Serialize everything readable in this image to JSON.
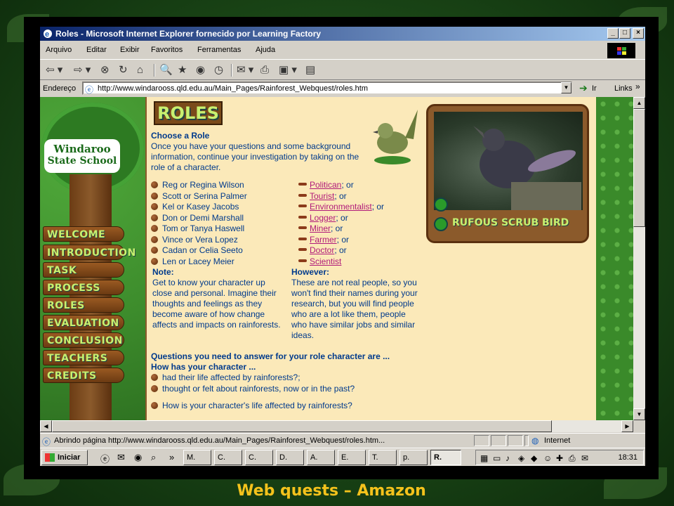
{
  "window": {
    "title": "Roles - Microsoft Internet Explorer fornecido por Learning Factory",
    "btn_min": "_",
    "btn_max": "□",
    "btn_close": "×"
  },
  "menu": [
    "Arquivo",
    "Editar",
    "Exibir",
    "Favoritos",
    "Ferramentas",
    "Ajuda"
  ],
  "address": {
    "label": "Endereço",
    "url": "http://www.windarooss.qld.edu.au/Main_Pages/Rainforest_Webquest/roles.htm",
    "go_label": "Ir",
    "links_label": "Links"
  },
  "nav": {
    "school_line1": "Windaroo",
    "school_line2": "State School",
    "items": [
      "WELCOME",
      "INTRODUCTION",
      "TASK",
      "PROCESS",
      "ROLES",
      "EVALUATION",
      "CONCLUSION",
      "TEACHERS",
      "CREDITS"
    ]
  },
  "page": {
    "heading": "ROLES",
    "choose_title": "Choose a Role",
    "choose_text": "Once you have your questions and some background information, continue your investigation by taking on the role of a character.",
    "photo_label": "RUFOUS SCRUB BIRD",
    "characters": [
      "Reg or Regina Wilson",
      "Scott or Serina Palmer",
      "Kel or Kasey Jacobs",
      "Don or Demi Marshall",
      "Tom or Tanya Haswell",
      "Vince or Vera Lopez",
      "Cadan or Celia Seeto",
      "Len or Lacey Meier"
    ],
    "roles": [
      {
        "link": "Politican",
        "suffix": "; or"
      },
      {
        "link": "Tourist",
        "suffix": "; or"
      },
      {
        "link": "Environmentalist",
        "suffix": "; or"
      },
      {
        "link": "Logger",
        "suffix": "; or"
      },
      {
        "link": "Miner",
        "suffix": "; or"
      },
      {
        "link": "Farmer",
        "suffix": "; or"
      },
      {
        "link": "Doctor",
        "suffix": "; or"
      },
      {
        "link": "Scientist",
        "suffix": ""
      }
    ],
    "note_title": "Note:",
    "note_text": "Get to know your character up close and personal. Imagine their thoughts and feelings as they become aware of how change affects and impacts on rainforests.",
    "however_title": "However:",
    "however_text": "These are not real people, so you won't find their names during your research, but you will find people who are a lot like them, people who have similar jobs and similar ideas.",
    "questions_title": "Questions you need to answer for your role character are ...",
    "how_title": "How has your character ...",
    "questions": [
      "had their life affected by rainforests?;",
      "thought or felt about rainforests, now or in the past?"
    ],
    "cut_line": "How is your character's life affected by rainforests?"
  },
  "status": {
    "message": "Abrindo página http://www.windarooss.qld.edu.au/Main_Pages/Rainforest_Webquest/roles.htm...",
    "zone": "Internet"
  },
  "taskbar": {
    "start": "Iniciar",
    "tasks": [
      "M.",
      "C.",
      "C.",
      "D.",
      "A.",
      "E.",
      "T.",
      "p.",
      "R."
    ],
    "clock": "18:31"
  },
  "caption": "Web quests – Amazon"
}
